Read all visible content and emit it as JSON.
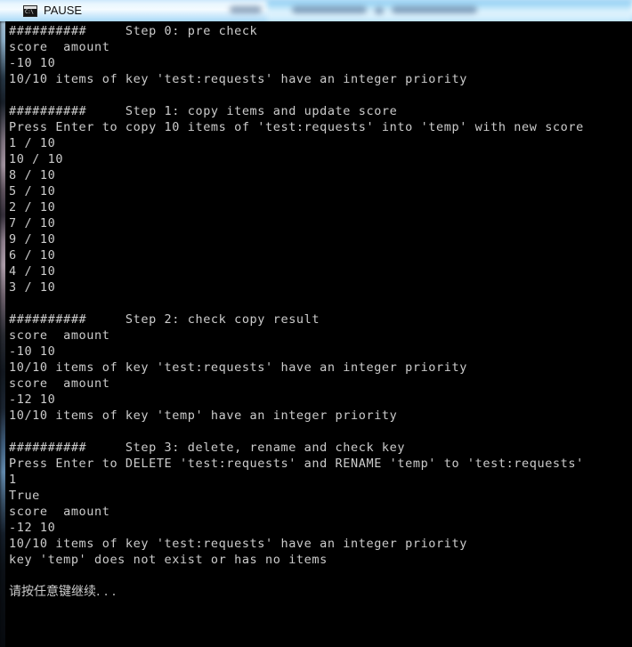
{
  "window": {
    "title": "PAUSE",
    "icon_name": "console-icon",
    "icon_glyph": "C:\\",
    "titlebar_color": "#cfe9fb",
    "background_color": "#000000",
    "text_color": "#cccccc"
  },
  "console": {
    "lines": [
      "##########     Step 0: pre check",
      "score  amount",
      "-10 10",
      "10/10 items of key 'test:requests' have an integer priority",
      "",
      "##########     Step 1: copy items and update score",
      "Press Enter to copy 10 items of 'test:requests' into 'temp' with new score",
      "1 / 10",
      "10 / 10",
      "8 / 10",
      "5 / 10",
      "2 / 10",
      "7 / 10",
      "9 / 10",
      "6 / 10",
      "4 / 10",
      "3 / 10",
      "",
      "##########     Step 2: check copy result",
      "score  amount",
      "-10 10",
      "10/10 items of key 'test:requests' have an integer priority",
      "score  amount",
      "-12 10",
      "10/10 items of key 'temp' have an integer priority",
      "",
      "##########     Step 3: delete, rename and check key",
      "Press Enter to DELETE 'test:requests' and RENAME 'temp' to 'test:requests'",
      "1",
      "True",
      "score  amount",
      "-12 10",
      "10/10 items of key 'test:requests' have an integer priority",
      "key 'temp' does not exist or has no items",
      "",
      "请按任意键继续. . ."
    ]
  }
}
